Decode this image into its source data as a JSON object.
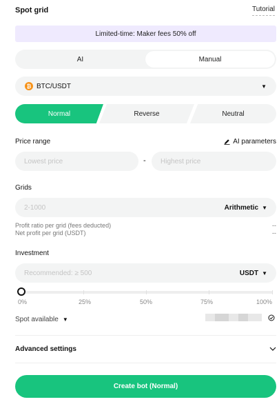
{
  "header": {
    "title": "Spot grid",
    "tutorial_label": "Tutorial"
  },
  "banner": {
    "text": "Limited-time: Maker fees 50% off"
  },
  "mode_toggle": {
    "ai_label": "AI",
    "manual_label": "Manual",
    "selected": "Manual"
  },
  "pair": {
    "label": "BTC/USDT",
    "icon": "bitcoin-icon",
    "icon_color": "#f7931a"
  },
  "strategy_tabs": {
    "normal": "Normal",
    "reverse": "Reverse",
    "neutral": "Neutral",
    "selected": "Normal"
  },
  "price_range": {
    "label": "Price range",
    "ai_params_label": "AI parameters",
    "low_placeholder": "Lowest price",
    "high_placeholder": "Highest price",
    "separator": "-"
  },
  "grids": {
    "label": "Grids",
    "placeholder": "2-1000",
    "mode": "Arithmetic",
    "profit_ratio_label": "Profit ratio per grid (fees deducted)",
    "profit_ratio_value": "--",
    "net_profit_label": "Net profit per grid (USDT)",
    "net_profit_value": "--"
  },
  "investment": {
    "label": "Investment",
    "placeholder": "Recommended: ≥ 500",
    "currency": "USDT",
    "slider_value_percent": 0,
    "slider_ticks": [
      "0%",
      "25%",
      "50%",
      "75%",
      "100%"
    ],
    "spot_available_label": "Spot available"
  },
  "advanced": {
    "label": "Advanced settings"
  },
  "create_button": {
    "label": "Create bot (Normal)"
  },
  "colors": {
    "accent": "#18c47e",
    "banner_bg": "#efeafe",
    "field_bg": "#f3f4f4"
  }
}
